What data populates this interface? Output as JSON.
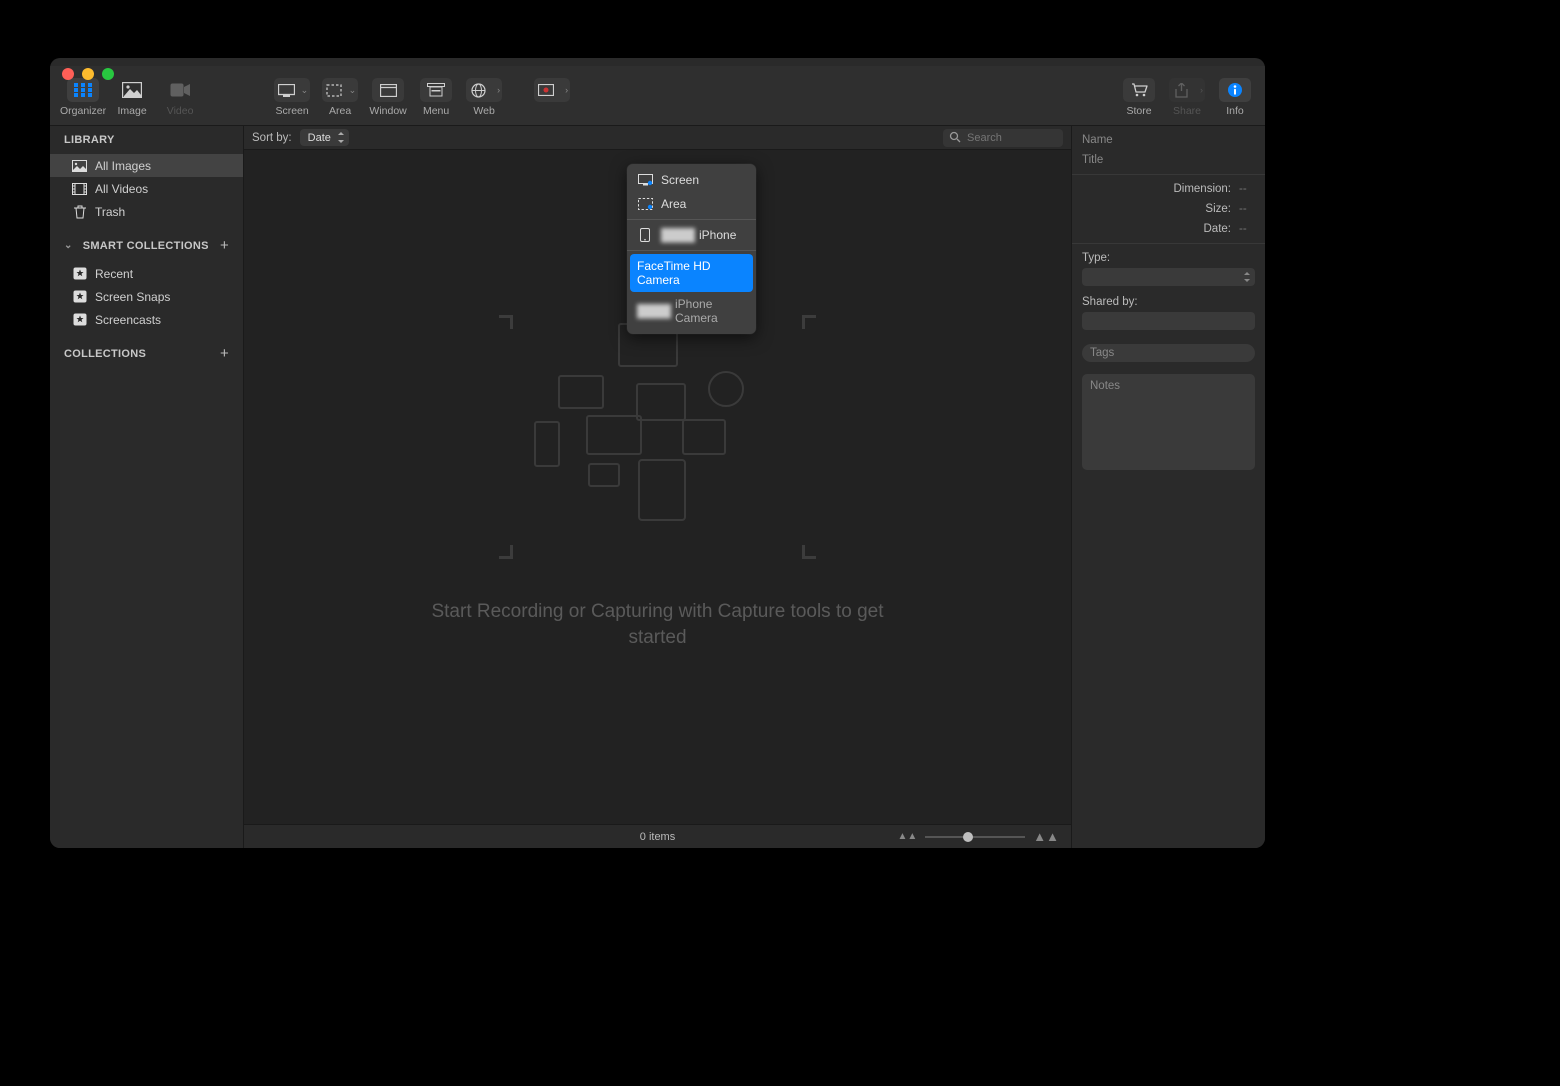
{
  "toolbar": {
    "left": [
      {
        "id": "organizer",
        "label": "Organizer",
        "selected": true
      },
      {
        "id": "image",
        "label": "Image",
        "selected": false
      },
      {
        "id": "video",
        "label": "Video",
        "selected": false,
        "disabled": true
      }
    ],
    "capture": [
      {
        "id": "screen",
        "label": "Screen"
      },
      {
        "id": "area",
        "label": "Area"
      },
      {
        "id": "window",
        "label": "Window"
      },
      {
        "id": "menu",
        "label": "Menu"
      },
      {
        "id": "web",
        "label": "Web"
      },
      {
        "id": "record",
        "label": ""
      }
    ],
    "right": [
      {
        "id": "store",
        "label": "Store"
      },
      {
        "id": "share",
        "label": "Share",
        "disabled": true
      },
      {
        "id": "info",
        "label": "Info",
        "selected": true
      }
    ]
  },
  "sidebar": {
    "section_library": "LIBRARY",
    "library_items": [
      {
        "id": "all-images",
        "label": "All Images",
        "selected": true
      },
      {
        "id": "all-videos",
        "label": "All Videos"
      },
      {
        "id": "trash",
        "label": "Trash"
      }
    ],
    "section_smart": "SMART COLLECTIONS",
    "smart_items": [
      {
        "id": "recent",
        "label": "Recent"
      },
      {
        "id": "screen-snaps",
        "label": "Screen Snaps"
      },
      {
        "id": "screencasts",
        "label": "Screencasts"
      }
    ],
    "section_collections": "COLLECTIONS"
  },
  "sortbar": {
    "label": "Sort by:",
    "sort_value": "Date",
    "search_placeholder": "Search"
  },
  "empty_state": {
    "message": "Start Recording or Capturing with Capture tools to get started"
  },
  "footer": {
    "item_count": "0 items"
  },
  "inspector": {
    "name_label": "Name",
    "title_label": "Title",
    "rows": [
      {
        "k": "Dimension:",
        "v": "--"
      },
      {
        "k": "Size:",
        "v": "--"
      },
      {
        "k": "Date:",
        "v": "--"
      }
    ],
    "type_label": "Type:",
    "shared_label": "Shared by:",
    "tags_label": "Tags",
    "notes_label": "Notes"
  },
  "popover": {
    "items": [
      {
        "id": "screen",
        "label": "Screen"
      },
      {
        "id": "area",
        "label": "Area"
      }
    ],
    "device_label": "iPhone",
    "camera_items": [
      {
        "id": "facetime",
        "label": "FaceTime HD Camera",
        "selected": true
      },
      {
        "id": "iphone-cam",
        "label": "iPhone Camera"
      }
    ]
  }
}
